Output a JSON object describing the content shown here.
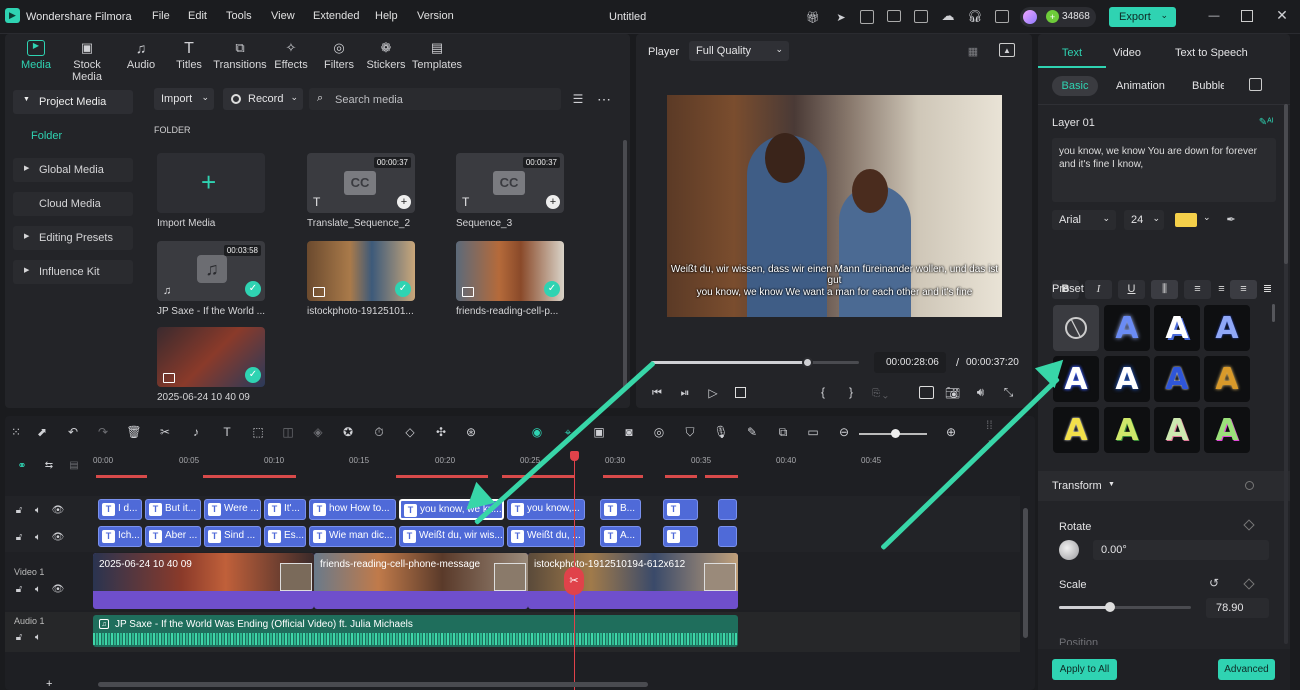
{
  "titlebar": {
    "app_name": "Wondershare Filmora",
    "menu": [
      "File",
      "Edit",
      "Tools",
      "View",
      "Extended",
      "Help",
      "Version"
    ],
    "project_title": "Untitled",
    "credits": "34868",
    "export_label": "Export"
  },
  "media_tabs": [
    "Media",
    "Stock Media",
    "Audio",
    "Titles",
    "Transitions",
    "Effects",
    "Filters",
    "Stickers",
    "Templates"
  ],
  "sidebar": {
    "project_media": "Project Media",
    "folder": "Folder",
    "global_media": "Global Media",
    "cloud_media": "Cloud Media",
    "editing_presets": "Editing Presets",
    "influence_kit": "Influence Kit"
  },
  "media_toolbar": {
    "import": "Import",
    "record": "Record",
    "search_placeholder": "Search media",
    "folder_heading": "FOLDER"
  },
  "media_items": [
    {
      "label": "Import Media",
      "duration": ""
    },
    {
      "label": "Translate_Sequence_2",
      "duration": "00:00:37"
    },
    {
      "label": "Sequence_3",
      "duration": "00:00:37"
    },
    {
      "label": "JP Saxe - If the World ...",
      "duration": "00:03:58"
    },
    {
      "label": "istockphoto-19125101...",
      "duration": ""
    },
    {
      "label": "friends-reading-cell-p...",
      "duration": ""
    },
    {
      "label": "2025-06-24 10 40 09",
      "duration": ""
    }
  ],
  "player": {
    "label": "Player",
    "quality": "Full Quality",
    "subtitle_de": "Weißt du, wir wissen, dass wir einen Mann füreinander wollen, und das ist gut",
    "subtitle_en": "you know, we know We want a man for each other and it's fine",
    "current_time": "00:00:28:06",
    "separator": "/",
    "total_time": "00:00:37:20",
    "progress": 0.75
  },
  "right_panel": {
    "tabs": [
      "Text",
      "Video",
      "Text to Speech"
    ],
    "subtabs": [
      "Basic",
      "Animation",
      "Bubble"
    ],
    "layer": "Layer 01",
    "text_content": "you know, we know You are down for forever and it's fine I know,",
    "font": "Arial",
    "size": "24",
    "highlight_color": "#f5d04a",
    "preset_label": "Preset",
    "transform_label": "Transform",
    "rotate_label": "Rotate",
    "rotate_value": "0.00°",
    "scale_label": "Scale",
    "scale_value": "78.90",
    "scale_fraction": 0.39,
    "position_label": "Position",
    "apply_all": "Apply to All",
    "advanced": "Advanced"
  },
  "timeline": {
    "ticks": [
      "00:00",
      "00:05",
      "00:10",
      "00:15",
      "00:20",
      "00:25",
      "00:30",
      "00:35",
      "00:40",
      "00:45"
    ],
    "track_labels": {
      "video1": "Video 1",
      "audio1": "Audio 1"
    },
    "title_row1": [
      "I d...",
      "But it...",
      "Were ...",
      "It'...",
      "how How to...",
      "you know, we kn...",
      "you know,...",
      "B...",
      "",
      ""
    ],
    "title_row2": [
      "Ich...",
      "Aber ...",
      "Sind ...",
      "Es...",
      "Wie man dic...",
      "Weißt du, wir wis...",
      "Weißt du, ...",
      "A...",
      "",
      ""
    ],
    "video_clips": [
      "2025-06-24 10 40 09",
      "friends-reading-cell-phone-message",
      "istockphoto-1912510194-612x612"
    ],
    "audio_clip": "JP Saxe - If the World Was Ending (Official Video) ft. Julia Michaels"
  },
  "colors": {
    "accent": "#2fd3b2",
    "clip_blue": "#4f6ad8",
    "video_purple": "#6f4fcc",
    "audio_teal": "#1f6e5c",
    "playhead": "#e0424a"
  }
}
